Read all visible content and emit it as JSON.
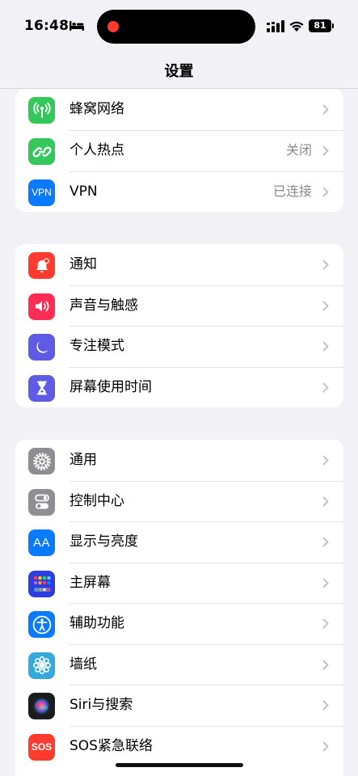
{
  "status_bar": {
    "time": "16:48",
    "battery_level": "81",
    "icons": [
      "bed-icon",
      "signal-icon",
      "wifi-icon",
      "battery-icon"
    ]
  },
  "nav": {
    "title": "设置"
  },
  "groups": [
    {
      "items": [
        {
          "label": "蜂窝网络",
          "value": "",
          "icon": "antenna-icon",
          "color": "#34c759"
        },
        {
          "label": "个人热点",
          "value": "关闭",
          "icon": "hotspot-link-icon",
          "color": "#34c759"
        },
        {
          "label": "VPN",
          "value": "已连接",
          "icon": "vpn-icon",
          "icon_text": "VPN",
          "color": "#0a7aff"
        }
      ]
    },
    {
      "items": [
        {
          "label": "通知",
          "value": "",
          "icon": "notification-bell-icon",
          "color": "#ff3b30"
        },
        {
          "label": "声音与触感",
          "value": "",
          "icon": "speaker-icon",
          "color": "#ff2d55"
        },
        {
          "label": "专注模式",
          "value": "",
          "icon": "moon-icon",
          "color": "#5e5ce6"
        },
        {
          "label": "屏幕使用时间",
          "value": "",
          "icon": "hourglass-icon",
          "color": "#5e5ce6"
        }
      ]
    },
    {
      "items": [
        {
          "label": "通用",
          "value": "",
          "icon": "gear-icon",
          "color": "#8e8e93"
        },
        {
          "label": "控制中心",
          "value": "",
          "icon": "toggles-icon",
          "color": "#8e8e93"
        },
        {
          "label": "显示与亮度",
          "value": "",
          "icon": "text-size-icon",
          "icon_text": "AA",
          "color": "#0a7aff"
        },
        {
          "label": "主屏幕",
          "value": "",
          "icon": "home-screen-grid-icon",
          "color": "#2c3ee0"
        },
        {
          "label": "辅助功能",
          "value": "",
          "icon": "accessibility-icon",
          "color": "#0a7aff"
        },
        {
          "label": "墙纸",
          "value": "",
          "icon": "flower-icon",
          "color": "#34aadc"
        },
        {
          "label": "Siri与搜索",
          "value": "",
          "icon": "siri-icon",
          "color": "#1c1c1e"
        },
        {
          "label": "SOS紧急联络",
          "value": "",
          "icon": "sos-icon",
          "icon_text": "SOS",
          "color": "#ff3b30"
        }
      ]
    }
  ]
}
